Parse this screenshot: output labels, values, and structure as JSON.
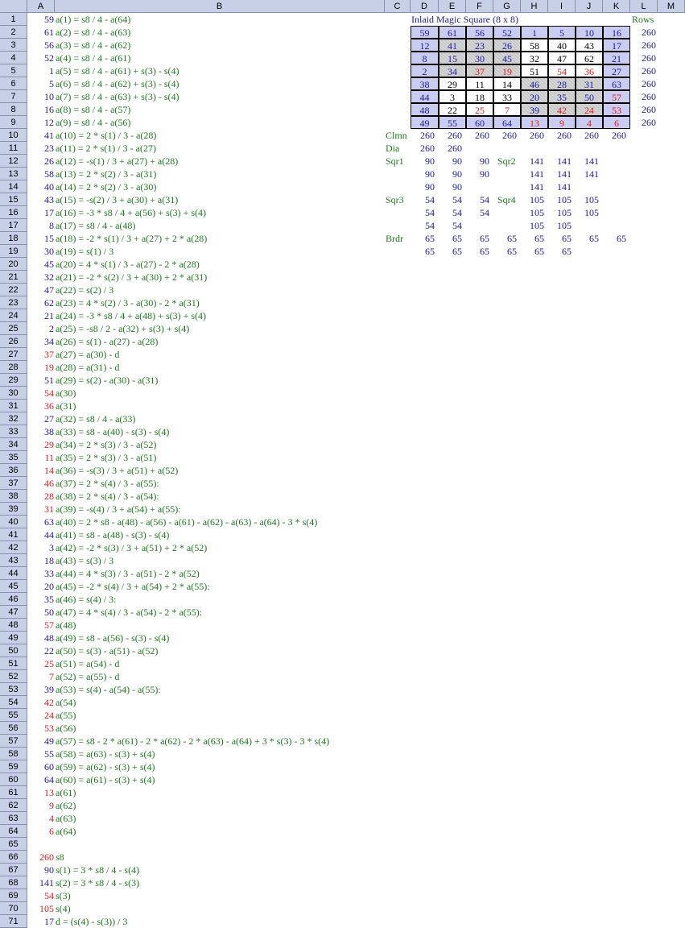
{
  "columns": [
    "A",
    "B",
    "C",
    "D",
    "E",
    "F",
    "G",
    "H",
    "I",
    "J",
    "K",
    "L",
    "M"
  ],
  "rows": [
    {
      "n": 1,
      "val": "59",
      "vc": "blue",
      "f": "a(1) = s8 / 4 - a(64)"
    },
    {
      "n": 2,
      "val": "61",
      "vc": "blue",
      "f": "a(2) = s8 / 4 - a(63)"
    },
    {
      "n": 3,
      "val": "56",
      "vc": "blue",
      "f": "a(3) = s8 / 4 - a(62)"
    },
    {
      "n": 4,
      "val": "52",
      "vc": "blue",
      "f": "a(4) = s8 / 4 - a(61)"
    },
    {
      "n": 5,
      "val": "1",
      "vc": "blue",
      "f": "a(5) = s8 / 4 - a(61) + s(3) - s(4)"
    },
    {
      "n": 6,
      "val": "5",
      "vc": "blue",
      "f": "a(6) = s8 / 4 - a(62) + s(3) - s(4)"
    },
    {
      "n": 7,
      "val": "10",
      "vc": "blue",
      "f": "a(7) = s8 / 4 - a(63) + s(3) - s(4)"
    },
    {
      "n": 8,
      "val": "16",
      "vc": "blue",
      "f": "a(8) = s8 / 4 - a(57)"
    },
    {
      "n": 9,
      "val": "12",
      "vc": "blue",
      "f": "a(9) = s8 / 4 - a(56)"
    },
    {
      "n": 10,
      "val": "41",
      "vc": "blue",
      "f": "a(10) = 2 * s(1) / 3 - a(28)"
    },
    {
      "n": 11,
      "val": "23",
      "vc": "blue",
      "f": "a(11) = 2 * s(1) / 3 - a(27)"
    },
    {
      "n": 12,
      "val": "26",
      "vc": "blue",
      "f": "a(12) = -s(1) / 3 + a(27) + a(28)"
    },
    {
      "n": 13,
      "val": "58",
      "vc": "blue",
      "f": "a(13) = 2 * s(2) / 3 - a(31)"
    },
    {
      "n": 14,
      "val": "40",
      "vc": "blue",
      "f": "a(14) = 2 * s(2) / 3 - a(30)"
    },
    {
      "n": 15,
      "val": "43",
      "vc": "blue",
      "f": "a(15) = -s(2) / 3 + a(30) + a(31)"
    },
    {
      "n": 16,
      "val": "17",
      "vc": "blue",
      "f": "a(16) = -3 * s8 / 4 + a(56) + s(3) + s(4)"
    },
    {
      "n": 17,
      "val": "8",
      "vc": "blue",
      "f": "a(17) = s8 / 4 - a(48)"
    },
    {
      "n": 18,
      "val": "15",
      "vc": "blue",
      "f": "a(18) = -2 * s(1) / 3 + a(27) + 2 * a(28)"
    },
    {
      "n": 19,
      "val": "30",
      "vc": "blue",
      "f": "a(19) = s(1) / 3"
    },
    {
      "n": 20,
      "val": "45",
      "vc": "blue",
      "f": "a(20) = 4 * s(1) / 3 - a(27) - 2 * a(28)"
    },
    {
      "n": 21,
      "val": "32",
      "vc": "blue",
      "f": "a(21) = -2 * s(2) / 3 + a(30) + 2 * a(31)"
    },
    {
      "n": 22,
      "val": "47",
      "vc": "blue",
      "f": "a(22) = s(2) / 3"
    },
    {
      "n": 23,
      "val": "62",
      "vc": "blue",
      "f": "a(23) = 4 * s(2) / 3 - a(30) - 2 * a(31)"
    },
    {
      "n": 24,
      "val": "21",
      "vc": "blue",
      "f": "a(24) = -3 * s8 / 4 + a(48) + s(3) + s(4)"
    },
    {
      "n": 25,
      "val": "2",
      "vc": "blue",
      "f": "a(25) = -s8 / 2 - a(32) + s(3) + s(4)"
    },
    {
      "n": 26,
      "val": "34",
      "vc": "blue",
      "f": "a(26) = s(1) - a(27) - a(28)"
    },
    {
      "n": 27,
      "val": "37",
      "vc": "red",
      "f": "a(27) = a(30) - d"
    },
    {
      "n": 28,
      "val": "19",
      "vc": "red",
      "f": "a(28) = a(31) - d"
    },
    {
      "n": 29,
      "val": "51",
      "vc": "blue",
      "f": "a(29) = s(2) - a(30) - a(31)"
    },
    {
      "n": 30,
      "val": "54",
      "vc": "red",
      "f": "a(30)"
    },
    {
      "n": 31,
      "val": "36",
      "vc": "red",
      "f": "a(31)"
    },
    {
      "n": 32,
      "val": "27",
      "vc": "blue",
      "f": "a(32) = s8 / 4 - a(33)"
    },
    {
      "n": 33,
      "val": "38",
      "vc": "blue",
      "f": "a(33) = s8 - a(40) - s(3) - s(4)"
    },
    {
      "n": 34,
      "val": "29",
      "vc": "red",
      "f": "a(34) = 2 * s(3) / 3 - a(52)"
    },
    {
      "n": 35,
      "val": "11",
      "vc": "red",
      "f": "a(35) = 2 * s(3) / 3 - a(51)"
    },
    {
      "n": 36,
      "val": "14",
      "vc": "red",
      "f": "a(36) = -s(3) / 3 + a(51) + a(52)"
    },
    {
      "n": 37,
      "val": "46",
      "vc": "red",
      "f": "a(37) = 2 * s(4) / 3 - a(55):"
    },
    {
      "n": 38,
      "val": "28",
      "vc": "red",
      "f": "a(38) = 2 * s(4) / 3 - a(54):"
    },
    {
      "n": 39,
      "val": "31",
      "vc": "red",
      "f": "a(39) = -s(4) / 3 + a(54) + a(55):"
    },
    {
      "n": 40,
      "val": "63",
      "vc": "blue",
      "f": "a(40) = 2 * s8 - a(48) - a(56) - a(61) - a(62) - a(63) - a(64) - 3 * s(4)"
    },
    {
      "n": 41,
      "val": "44",
      "vc": "blue",
      "f": "a(41) = s8 - a(48) - s(3) - s(4)"
    },
    {
      "n": 42,
      "val": "3",
      "vc": "blue",
      "f": "a(42) = -2 * s(3) / 3 + a(51) + 2 * a(52)"
    },
    {
      "n": 43,
      "val": "18",
      "vc": "blue",
      "f": "a(43) = s(3) / 3"
    },
    {
      "n": 44,
      "val": "33",
      "vc": "blue",
      "f": "a(44) = 4 * s(3) / 3 - a(51) - 2 * a(52)"
    },
    {
      "n": 45,
      "val": "20",
      "vc": "blue",
      "f": "a(45) = -2 * s(4) / 3 + a(54) + 2 * a(55):"
    },
    {
      "n": 46,
      "val": "35",
      "vc": "blue",
      "f": "a(46) = s(4) / 3:"
    },
    {
      "n": 47,
      "val": "50",
      "vc": "blue",
      "f": "a(47) = 4 * s(4) / 3 - a(54) - 2 * a(55):"
    },
    {
      "n": 48,
      "val": "57",
      "vc": "red",
      "f": "a(48)"
    },
    {
      "n": 49,
      "val": "48",
      "vc": "blue",
      "f": "a(49) = s8 - a(56) - s(3) - s(4)"
    },
    {
      "n": 50,
      "val": "22",
      "vc": "blue",
      "f": "a(50) = s(3) - a(51) - a(52)"
    },
    {
      "n": 51,
      "val": "25",
      "vc": "red",
      "f": "a(51) = a(54) - d"
    },
    {
      "n": 52,
      "val": "7",
      "vc": "red",
      "f": "a(52) = a(55) - d"
    },
    {
      "n": 53,
      "val": "39",
      "vc": "blue",
      "f": "a(53) = s(4) - a(54) - a(55):"
    },
    {
      "n": 54,
      "val": "42",
      "vc": "red",
      "f": "a(54)"
    },
    {
      "n": 55,
      "val": "24",
      "vc": "red",
      "f": "a(55)"
    },
    {
      "n": 56,
      "val": "53",
      "vc": "red",
      "f": "a(56)"
    },
    {
      "n": 57,
      "val": "49",
      "vc": "blue",
      "f": "a(57) = s8 - 2 * a(61) - 2 * a(62) - 2 * a(63) - a(64) + 3 * s(3) - 3 * s(4)"
    },
    {
      "n": 58,
      "val": "55",
      "vc": "blue",
      "f": "a(58) = a(63) - s(3) + s(4)"
    },
    {
      "n": 59,
      "val": "60",
      "vc": "blue",
      "f": "a(59) = a(62) - s(3) + s(4)"
    },
    {
      "n": 60,
      "val": "64",
      "vc": "blue",
      "f": "a(60) = a(61) - s(3) + s(4)"
    },
    {
      "n": 61,
      "val": "13",
      "vc": "red",
      "f": "a(61)"
    },
    {
      "n": 62,
      "val": "9",
      "vc": "red",
      "f": "a(62)"
    },
    {
      "n": 63,
      "val": "4",
      "vc": "red",
      "f": "a(63)"
    },
    {
      "n": 64,
      "val": "6",
      "vc": "red",
      "f": "a(64)"
    },
    {
      "n": 65,
      "val": "",
      "vc": "blue",
      "f": ""
    },
    {
      "n": 66,
      "val": "260",
      "vc": "red",
      "f": "s8"
    },
    {
      "n": 67,
      "val": "90",
      "vc": "blue",
      "f": "s(1) = 3 * s8 / 4 - s(4)"
    },
    {
      "n": 68,
      "val": "141",
      "vc": "blue",
      "f": "s(2) = 3 * s8 / 4 - s(3)"
    },
    {
      "n": 69,
      "val": "54",
      "vc": "red",
      "f": "s(3)"
    },
    {
      "n": 70,
      "val": "105",
      "vc": "red",
      "f": "s(4)"
    },
    {
      "n": 71,
      "val": "17",
      "vc": "blue",
      "f": "d = (s(4) - s(3)) / 3"
    }
  ],
  "square": {
    "title": "Inlaid Magic Square (8 x 8)",
    "rows_label": "Rows",
    "values": [
      [
        "59",
        "61",
        "56",
        "52",
        "1",
        "5",
        "10",
        "16"
      ],
      [
        "12",
        "41",
        "23",
        "26",
        "58",
        "40",
        "43",
        "17"
      ],
      [
        "8",
        "15",
        "30",
        "45",
        "32",
        "47",
        "62",
        "21"
      ],
      [
        "2",
        "34",
        "37",
        "19",
        "51",
        "54",
        "36",
        "27"
      ],
      [
        "38",
        "29",
        "11",
        "14",
        "46",
        "28",
        "31",
        "63"
      ],
      [
        "44",
        "3",
        "18",
        "33",
        "20",
        "35",
        "50",
        "57"
      ],
      [
        "48",
        "22",
        "25",
        "7",
        "39",
        "42",
        "24",
        "53"
      ],
      [
        "49",
        "55",
        "60",
        "64",
        "13",
        "9",
        "4",
        "6"
      ]
    ],
    "text_colors": [
      [
        "blue",
        "blue",
        "blue",
        "blue",
        "blue",
        "blue",
        "blue",
        "blue"
      ],
      [
        "blue",
        "blue",
        "blue",
        "blue",
        "black",
        "black",
        "black",
        "blue"
      ],
      [
        "blue",
        "blue",
        "blue",
        "blue",
        "black",
        "black",
        "black",
        "blue"
      ],
      [
        "blue",
        "blue",
        "red",
        "red",
        "black",
        "red",
        "red",
        "blue"
      ],
      [
        "blue",
        "black",
        "black",
        "black",
        "blue",
        "blue",
        "blue",
        "blue"
      ],
      [
        "blue",
        "black",
        "black",
        "black",
        "blue",
        "blue",
        "blue",
        "red"
      ],
      [
        "blue",
        "black",
        "red",
        "red",
        "blue",
        "red",
        "red",
        "red"
      ],
      [
        "blue",
        "blue",
        "blue",
        "blue",
        "red",
        "red",
        "red",
        "red"
      ]
    ],
    "fills": [
      [
        "blue",
        "blue",
        "blue",
        "blue",
        "blue",
        "blue",
        "blue",
        "blue"
      ],
      [
        "blue",
        "grey",
        "grey",
        "grey",
        "white",
        "white",
        "white",
        "blue"
      ],
      [
        "blue",
        "grey",
        "grey",
        "grey",
        "white",
        "white",
        "white",
        "blue"
      ],
      [
        "blue",
        "grey",
        "grey",
        "grey",
        "white",
        "white",
        "white",
        "blue"
      ],
      [
        "blue",
        "white",
        "white",
        "white",
        "grey",
        "grey",
        "grey",
        "blue"
      ],
      [
        "blue",
        "white",
        "white",
        "white",
        "grey",
        "grey",
        "grey",
        "blue"
      ],
      [
        "blue",
        "white",
        "white",
        "white",
        "grey",
        "grey",
        "grey",
        "blue"
      ],
      [
        "blue",
        "blue",
        "blue",
        "blue",
        "blue",
        "blue",
        "blue",
        "blue"
      ]
    ],
    "row_sums": [
      "260",
      "260",
      "260",
      "260",
      "260",
      "260",
      "260",
      "260"
    ]
  },
  "checks": {
    "clmn": {
      "label": "Clmn",
      "values": [
        "260",
        "260",
        "260",
        "260",
        "260",
        "260",
        "260",
        "260"
      ]
    },
    "dia": {
      "label": "Dia",
      "values": [
        "260",
        "260"
      ]
    },
    "sqr1": {
      "label": "Sqr1",
      "rows": [
        [
          "90",
          "90",
          "90"
        ],
        [
          "90",
          "90",
          "90"
        ],
        [
          "90",
          "90"
        ]
      ]
    },
    "sqr2": {
      "label": "Sqr2",
      "rows": [
        [
          "141",
          "141",
          "141"
        ],
        [
          "141",
          "141",
          "141"
        ],
        [
          "141",
          "141"
        ]
      ]
    },
    "sqr3": {
      "label": "Sqr3",
      "rows": [
        [
          "54",
          "54",
          "54"
        ],
        [
          "54",
          "54",
          "54"
        ],
        [
          "54",
          "54"
        ]
      ]
    },
    "sqr4": {
      "label": "Sqr4",
      "rows": [
        [
          "105",
          "105",
          "105"
        ],
        [
          "105",
          "105",
          "105"
        ],
        [
          "105",
          "105"
        ]
      ]
    },
    "brdr": {
      "label": "Brdr",
      "rows": [
        [
          "65",
          "65",
          "65",
          "65",
          "65",
          "65",
          "65",
          "65"
        ],
        [
          "65",
          "65",
          "65",
          "65",
          "65",
          "65"
        ]
      ]
    }
  }
}
